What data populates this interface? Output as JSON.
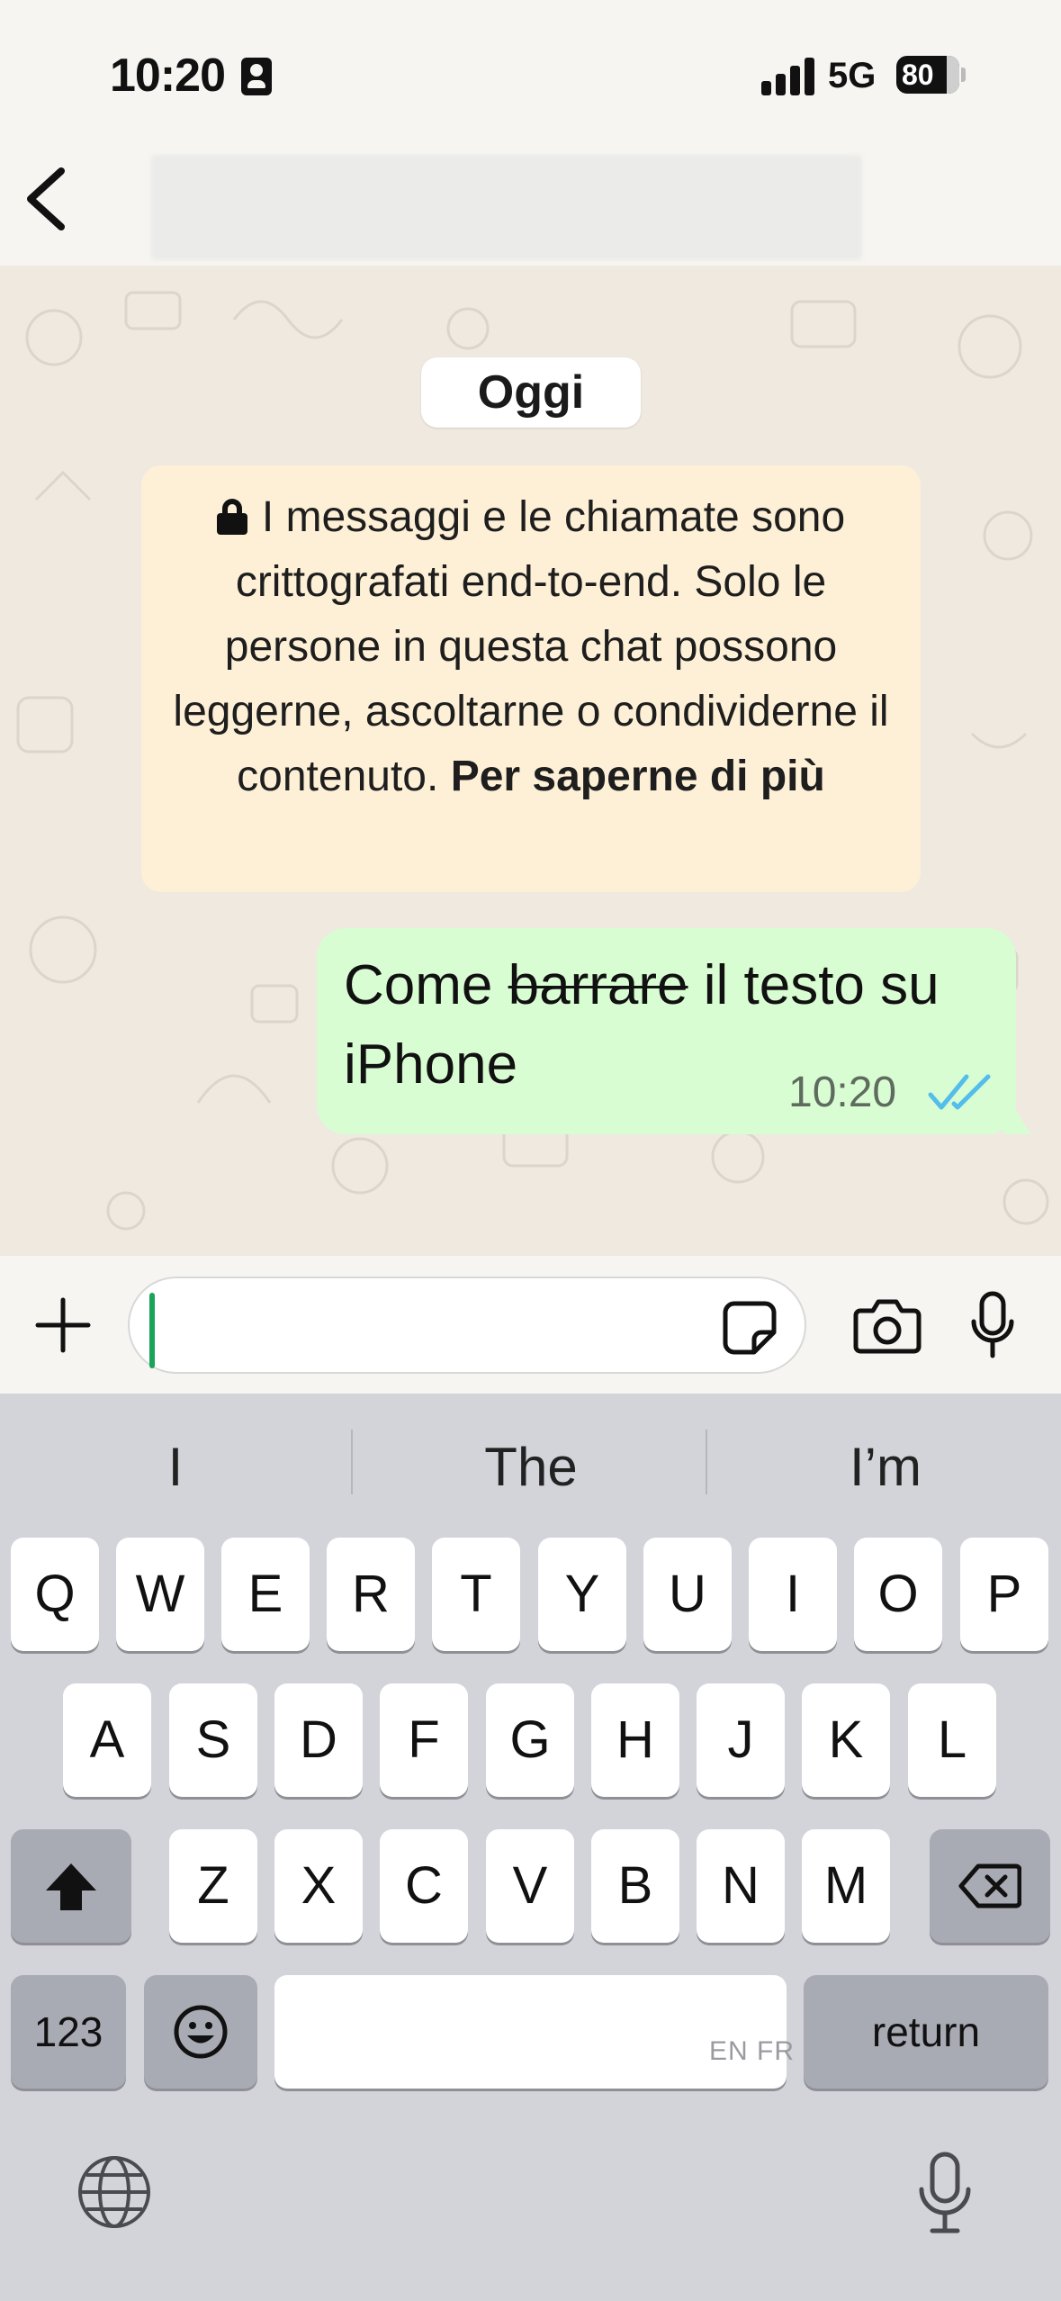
{
  "status_bar": {
    "time": "10:20",
    "network": "5G",
    "battery": "80"
  },
  "chat": {
    "date_label": "Oggi",
    "encryption_notice": {
      "text": "I messaggi e le chiamate sono crittografati end-to-end. Solo le persone in questa chat possono leggerne, ascoltarne o condividerne il contenuto.",
      "link": "Per saperne di più"
    },
    "outgoing_message": {
      "text_before": "Come ",
      "text_struck": "barrare",
      "text_after": " il testo su iPhone",
      "time": "10:20",
      "status": "read"
    }
  },
  "keyboard": {
    "suggestions": [
      "I",
      "The",
      "I’m"
    ],
    "row1": [
      "Q",
      "W",
      "E",
      "R",
      "T",
      "Y",
      "U",
      "I",
      "O",
      "P"
    ],
    "row2": [
      "A",
      "S",
      "D",
      "F",
      "G",
      "H",
      "J",
      "K",
      "L"
    ],
    "row3": [
      "Z",
      "X",
      "C",
      "V",
      "B",
      "N",
      "M"
    ],
    "numbers_label": "123",
    "return_label": "return",
    "language_indicator": "EN FR"
  },
  "colors": {
    "bubble_outgoing": "#d9fdd3",
    "notice_bg": "#fdf0d6",
    "read_ticks": "#53bdeb",
    "cursor": "#1aa35b"
  },
  "icons": [
    "back-icon",
    "lock-icon",
    "read-ticks-icon",
    "plus-icon",
    "sticker-icon",
    "camera-icon",
    "mic-icon",
    "shift-icon",
    "backspace-icon",
    "emoji-icon",
    "globe-icon",
    "dictation-mic-icon"
  ]
}
